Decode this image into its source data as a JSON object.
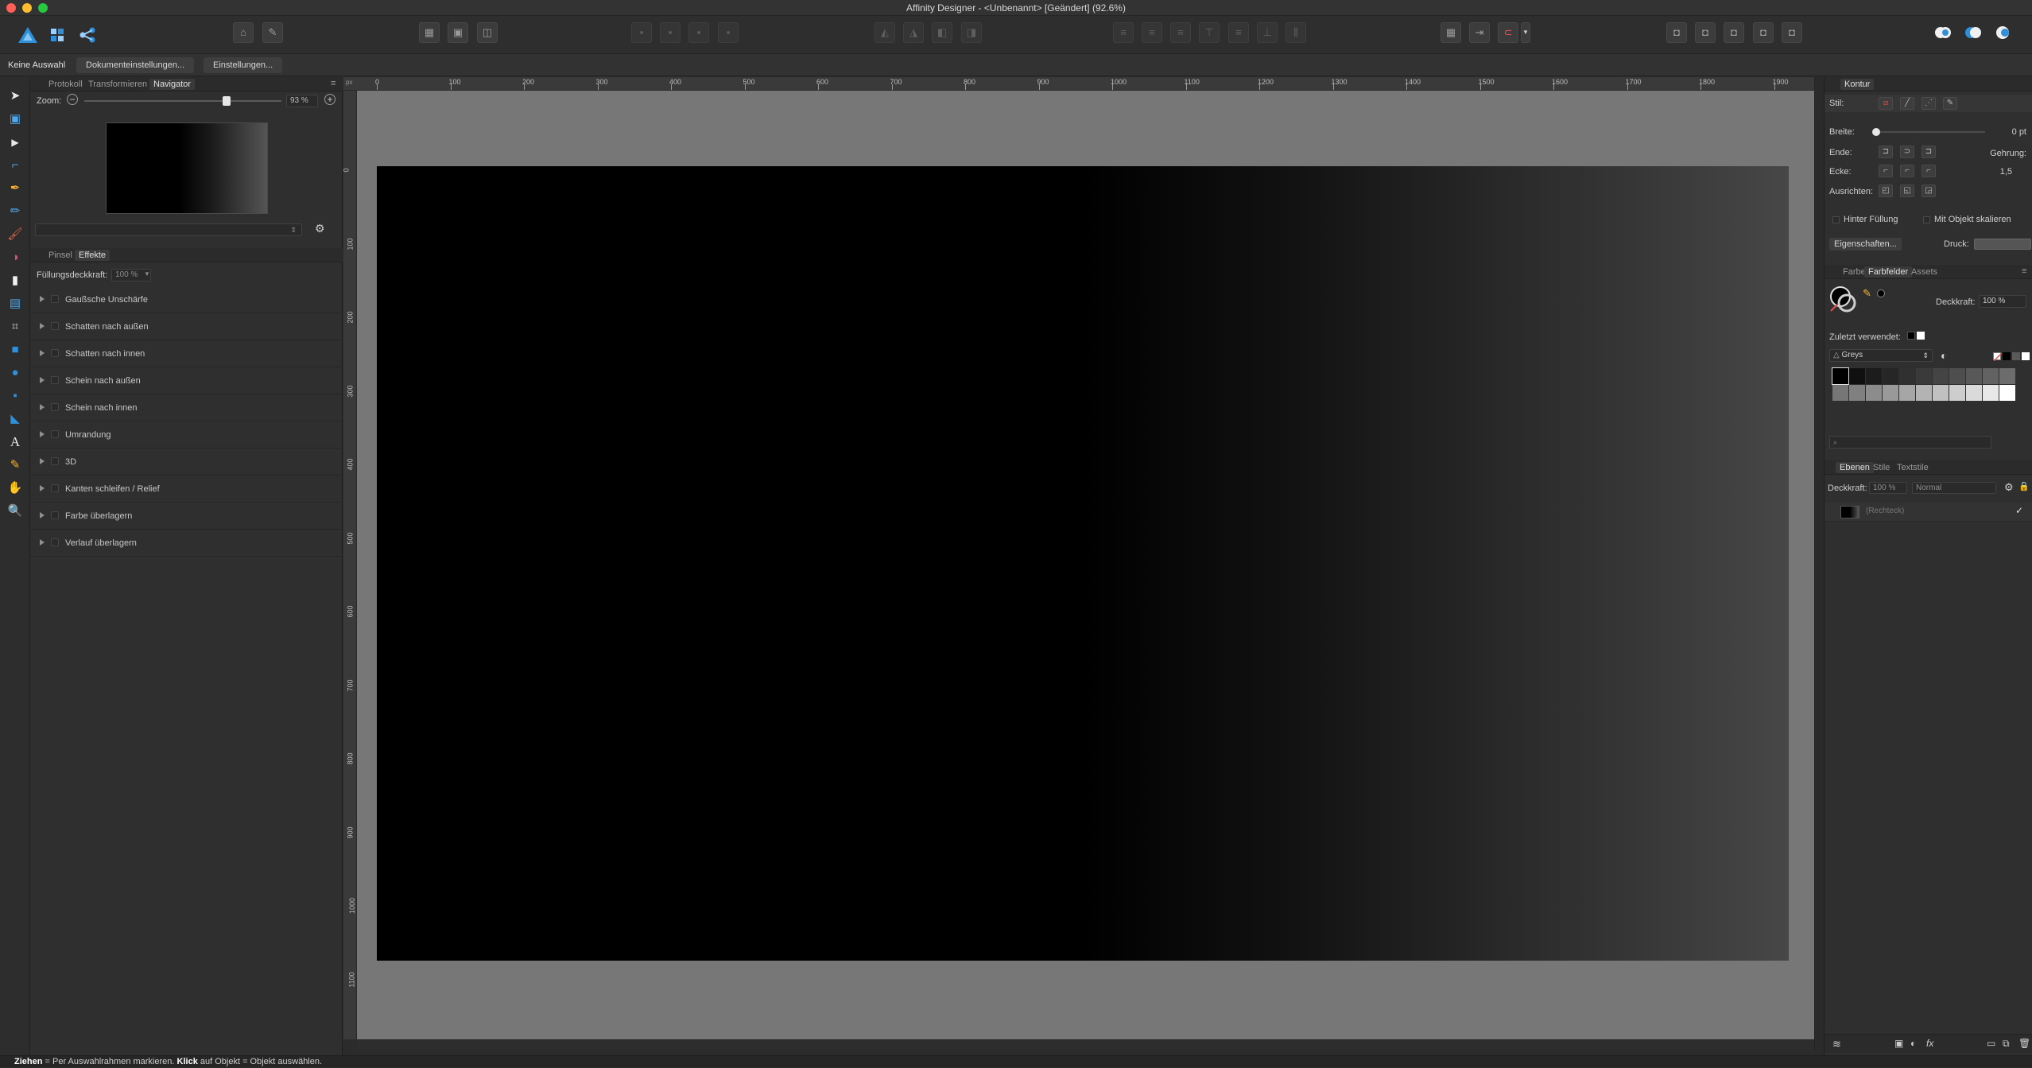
{
  "window": {
    "title": "Affinity Designer - <Unbenannt> [Geändert] (92.6%)"
  },
  "context_toolbar": {
    "selection_label": "Keine Auswahl",
    "document_settings_label": "Dokumenteinstellungen...",
    "settings_label": "Einstellungen..."
  },
  "left_panel": {
    "tabs": [
      {
        "label": "Protokoll"
      },
      {
        "label": "Transformieren"
      },
      {
        "label": "Navigator"
      }
    ],
    "navigator": {
      "zoom_label": "Zoom:",
      "zoom_value": "93 %",
      "zoom_fraction": 0.72
    },
    "fx_tabs": [
      {
        "label": "Pinsel"
      },
      {
        "label": "Effekte"
      }
    ],
    "fill_opacity_label": "Füllungsdeckkraft:",
    "fill_opacity_value": "100 %",
    "effects": [
      {
        "label": "Gaußsche Unschärfe"
      },
      {
        "label": "Schatten nach außen"
      },
      {
        "label": "Schatten nach innen"
      },
      {
        "label": "Schein nach außen"
      },
      {
        "label": "Schein nach innen"
      },
      {
        "label": "Umrandung"
      },
      {
        "label": "3D"
      },
      {
        "label": "Kanten schleifen / Relief"
      },
      {
        "label": "Farbe überlagern"
      },
      {
        "label": "Verlauf überlagern"
      }
    ]
  },
  "rulers": {
    "unit": "px",
    "top": [
      "0",
      "100",
      "200",
      "300",
      "400",
      "500",
      "600",
      "700",
      "800",
      "900",
      "1000",
      "1100",
      "1200",
      "1300",
      "1400",
      "1500",
      "1600",
      "1700",
      "1800",
      "1900"
    ],
    "left": [
      "0",
      "100",
      "200",
      "300",
      "400",
      "500",
      "600",
      "700",
      "800",
      "900",
      "1000",
      "1100"
    ]
  },
  "stroke_panel": {
    "title": "Kontur",
    "style_label": "Stil:",
    "width_label": "Breite:",
    "width_value": "0 pt",
    "cap_label": "Ende:",
    "miter_label": "Gehrung:",
    "corner_label": "Ecke:",
    "miter_value": "1,5",
    "align_label": "Ausrichten:",
    "behind_fill_label": "Hinter Füllung",
    "scale_with_object_label": "Mit Objekt skalieren",
    "properties_label": "Eigenschaften...",
    "pressure_label": "Druck:"
  },
  "swatches_panel": {
    "tabs": [
      {
        "label": "Farbe"
      },
      {
        "label": "Farbfelder"
      },
      {
        "label": "Assets"
      }
    ],
    "opacity_label": "Deckkraft:",
    "opacity_value": "100 %",
    "recently_used_label": "Zuletzt verwendet:",
    "palette_name": "Greys",
    "greys": [
      "#000000",
      "#101010",
      "#1c1c1c",
      "#262626",
      "#303030",
      "#3a3a3a",
      "#444444",
      "#4e4e4e",
      "#585858",
      "#626262",
      "#6c6c6c",
      "#767676",
      "#808080",
      "#8c8c8c",
      "#999999",
      "#a6a6a6",
      "#b3b3b3",
      "#c0c0c0",
      "#cdcdcd",
      "#dadada",
      "#e8e8e8",
      "#ffffff"
    ]
  },
  "layers_panel": {
    "tabs": [
      {
        "label": "Ebenen"
      },
      {
        "label": "Stile"
      },
      {
        "label": "Textstile"
      }
    ],
    "opacity_label": "Deckkraft:",
    "opacity_value": "100 %",
    "blend_mode": "Normal",
    "layers": [
      {
        "name": "(Rechteck)"
      }
    ]
  },
  "status_bar": {
    "drag_key": "Ziehen",
    "drag_text": " = Per Auswahlrahmen markieren. ",
    "click_key": "Klick",
    "click_text": " auf Objekt = Objekt auswählen."
  },
  "colors": {
    "accent": "#2f8fd9",
    "canvas": "#777777",
    "panel": "#2f2f2f"
  }
}
